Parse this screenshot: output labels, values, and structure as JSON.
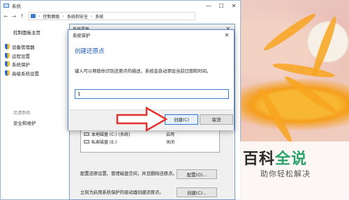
{
  "system_window": {
    "title": "系统",
    "controls": {
      "minimize": "—",
      "maximize": "☐",
      "close": "✕"
    },
    "address": {
      "nav_back": "←",
      "nav_forward": "→",
      "nav_up": "↑",
      "crumbs": [
        "控制面板",
        "系统和安全",
        "系统"
      ],
      "separator": "›"
    },
    "sidebar": {
      "home": "控制面板主页",
      "links": [
        "设备管理器",
        "远程设置",
        "系统保护",
        "高级系统设置"
      ],
      "see_also": "另请参阅",
      "footer_link": "安全和维护"
    }
  },
  "properties_dialog": {
    "title": "系统属性",
    "close": "✕",
    "table_rows": [
      {
        "drive": "本地磁盘 (C:) (系统)",
        "status": "启用"
      },
      {
        "drive": "私家磁盘 (E:)",
        "status": "关闭"
      }
    ],
    "configure_text": "配置还原设置、管理磁盘空间，并且删除还原点。",
    "configure_button": "配置(O)...",
    "create_text": "立刻为启用系统保护的驱动器创建还原点。",
    "create_button": "创建(C)..."
  },
  "restore_dialog": {
    "title": "系统保护",
    "close": "✕",
    "heading": "创建还原点",
    "description": "键入可以帮助你识别还原点的描述。系统会自动添加当前日期和时间。",
    "input_value": "1",
    "create_button": "创建(C)",
    "cancel_button": "取消"
  },
  "watermark": {
    "title_part1": "百科",
    "title_part2": "全说",
    "subtitle": "助你轻松解决"
  },
  "colors": {
    "accent": "#1a57b4",
    "arrow": "#e53030",
    "arrow_fill": "#ffffff",
    "brand_green": "#2aa36b"
  }
}
